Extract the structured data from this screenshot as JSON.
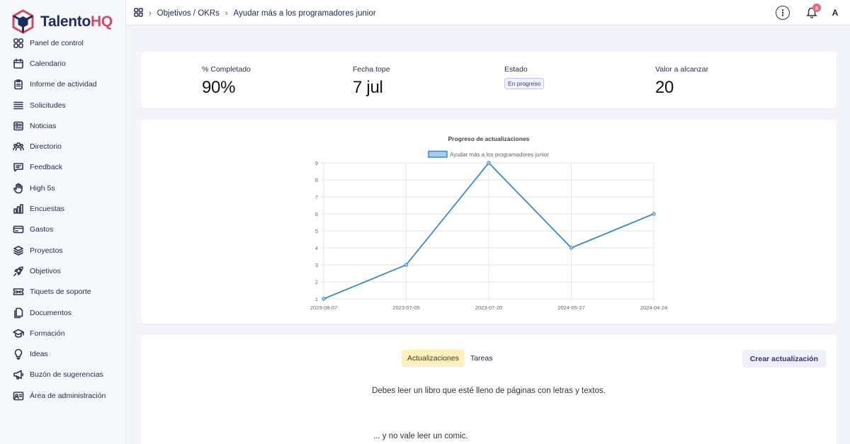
{
  "app": {
    "name_part1": "Talento",
    "name_part2": "HQ"
  },
  "sidebar": {
    "items": [
      {
        "label": "Panel de control",
        "icon": "grid-icon"
      },
      {
        "label": "Calendario",
        "icon": "calendar-icon"
      },
      {
        "label": "Informe de actividad",
        "icon": "clipboard-icon"
      },
      {
        "label": "Solicitudes",
        "icon": "list-icon"
      },
      {
        "label": "Noticias",
        "icon": "newspaper-icon"
      },
      {
        "label": "Directorio",
        "icon": "users-icon"
      },
      {
        "label": "Feedback",
        "icon": "message-icon"
      },
      {
        "label": "High 5s",
        "icon": "hand-icon"
      },
      {
        "label": "Encuestas",
        "icon": "bar-chart-icon"
      },
      {
        "label": "Gastos",
        "icon": "credit-card-icon"
      },
      {
        "label": "Proyectos",
        "icon": "layers-icon"
      },
      {
        "label": "Objetivos",
        "icon": "rocket-icon"
      },
      {
        "label": "Tiquets de soporte",
        "icon": "ticket-icon"
      },
      {
        "label": "Documentos",
        "icon": "documents-icon"
      },
      {
        "label": "Formación",
        "icon": "graduation-cap-icon"
      },
      {
        "label": "Ideas",
        "icon": "lightbulb-icon"
      },
      {
        "label": "Buzón de sugerencias",
        "icon": "megaphone-icon"
      },
      {
        "label": "Área de administración",
        "icon": "id-card-icon"
      }
    ]
  },
  "header": {
    "breadcrumb": [
      "Objetivos / OKRs",
      "Ayudar más a los programadores junior"
    ],
    "notifications_count": "8",
    "avatar_initial": "A"
  },
  "stats": {
    "completed_label": "% Completado",
    "completed_value": "90%",
    "deadline_label": "Fecha tope",
    "deadline_value": "7 jul",
    "status_label": "Estado",
    "status_value": "En progreso",
    "target_label": "Valor a alcanzar",
    "target_value": "20"
  },
  "chart_data": {
    "type": "line",
    "title": "Progreso de actualizaciones",
    "categories": [
      "2023-08-07",
      "2023-07-05",
      "2023-07-20",
      "2024-05-27",
      "2024-04-24"
    ],
    "series": [
      {
        "name": "Ayudar más a los programadores junior",
        "values": [
          1,
          3,
          9,
          4,
          6
        ]
      }
    ],
    "ylim": [
      1,
      9
    ],
    "yticks": [
      1,
      2,
      3,
      4,
      5,
      6,
      7,
      8,
      9
    ],
    "grid": true,
    "legend": "top",
    "color": "#3b8bc2"
  },
  "updates": {
    "tabs": [
      {
        "label": "Actualizaciones",
        "active": true
      },
      {
        "label": "Tareas",
        "active": false
      }
    ],
    "create_button": "Crear actualización",
    "text1": "Debes leer un libro que esté lleno de páginas con letras y textos.",
    "text2": "... y no vale leer un comic."
  }
}
